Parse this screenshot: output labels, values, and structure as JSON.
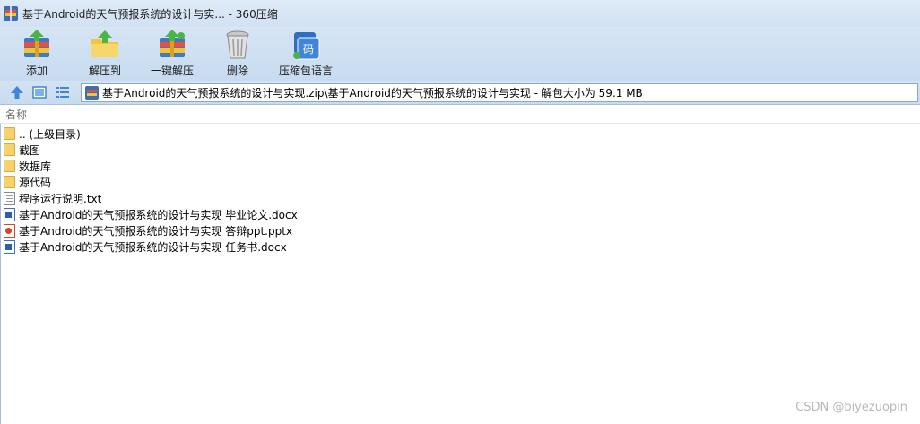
{
  "window": {
    "title": "基于Android的天气预报系统的设计与实... - 360压缩"
  },
  "toolbar": {
    "items": [
      {
        "label": "添加",
        "icon": "add-archive-icon"
      },
      {
        "label": "解压到",
        "icon": "extract-to-icon"
      },
      {
        "label": "一键解压",
        "icon": "one-click-extract-icon"
      },
      {
        "label": "删除",
        "icon": "delete-trash-icon"
      },
      {
        "label": "压缩包语言",
        "icon": "archive-language-icon"
      }
    ]
  },
  "pathbar": {
    "path": "基于Android的天气预报系统的设计与实现.zip\\基于Android的天气预报系统的设计与实现 - 解包大小为 59.1 MB"
  },
  "list": {
    "header": "名称",
    "items": [
      {
        "name": ".. (上级目录)",
        "type": "folder"
      },
      {
        "name": "截图",
        "type": "folder"
      },
      {
        "name": "数据库",
        "type": "folder"
      },
      {
        "name": "源代码",
        "type": "folder"
      },
      {
        "name": "程序运行说明.txt",
        "type": "txt"
      },
      {
        "name": "基于Android的天气预报系统的设计与实现 毕业论文.docx",
        "type": "docx"
      },
      {
        "name": "基于Android的天气预报系统的设计与实现 答辩ppt.pptx",
        "type": "pptx"
      },
      {
        "name": "基于Android的天气预报系统的设计与实现 任务书.docx",
        "type": "docx"
      }
    ]
  },
  "watermark": "CSDN @biyezuopin",
  "colors": {
    "toolbar_bg": "#c7dbf0",
    "titlebar_bg": "#d2e2f4",
    "folder": "#f7d26a",
    "word": "#2b5fad",
    "ppt": "#d24726"
  }
}
